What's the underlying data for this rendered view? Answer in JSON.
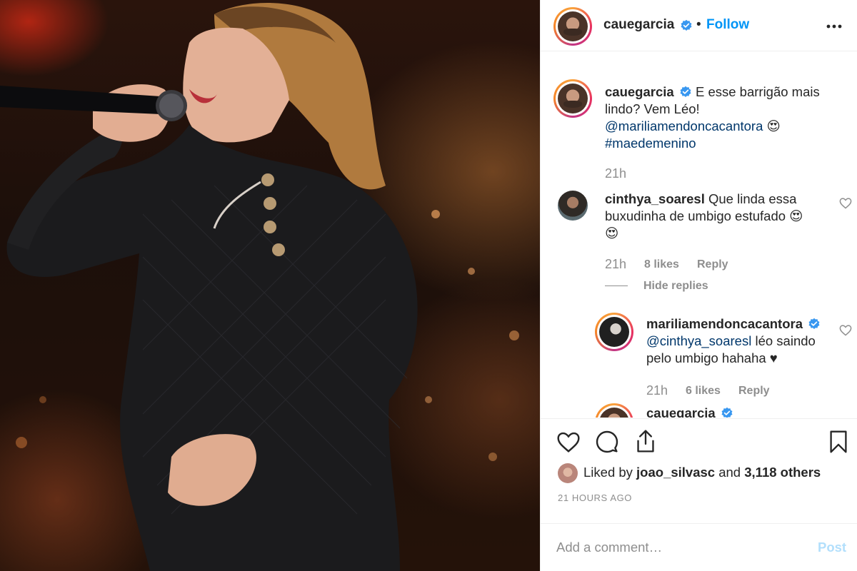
{
  "photo": {
    "alt": ""
  },
  "header": {
    "username": "cauegarcia",
    "separator": "•",
    "follow_label": "Follow"
  },
  "caption": {
    "username": "cauegarcia",
    "text_line1": "E esse barrigão mais",
    "text_line2": "lindo? Vem Léo!",
    "mention": "@mariliamendoncacantora",
    "emoji": "😍",
    "hashtag": "#maedemenino",
    "time": "21h"
  },
  "comments": [
    {
      "username": "cinthya_soaresl",
      "text_line1": "Que linda essa",
      "text_line2": "buxudinha de umbigo estufado",
      "emoji1": "😍",
      "emoji2": "😍",
      "time": "21h",
      "likes": "8 likes",
      "reply_label": "Reply",
      "hide_replies_label": "Hide replies"
    }
  ],
  "replies": [
    {
      "username": "mariliamendoncacantora",
      "mention": "@cinthya_soaresl",
      "text_line1": "léo saindo",
      "text_line2": "pelo umbigo hahaha ♥",
      "time": "21h",
      "likes": "6 likes",
      "reply_label": "Reply"
    },
    {
      "username": "cauegarcia"
    }
  ],
  "actions": {
    "liked_by_prefix": "Liked by",
    "liked_by_user": "joao_silvasc",
    "liked_by_and": "and",
    "liked_by_others": "3,118 others",
    "timestamp": "21 HOURS AGO"
  },
  "add_comment": {
    "placeholder": "Add a comment…",
    "post_label": "Post"
  },
  "colors": {
    "link_blue": "#0095f6",
    "mention_navy": "#00376b",
    "muted_gray": "#8e8e8e",
    "post_disabled": "#b2dffc",
    "verified": "#3897f0"
  },
  "icons": [
    "verified-badge-icon",
    "more-options-icon",
    "heart-icon",
    "comment-icon",
    "share-icon",
    "bookmark-icon"
  ]
}
